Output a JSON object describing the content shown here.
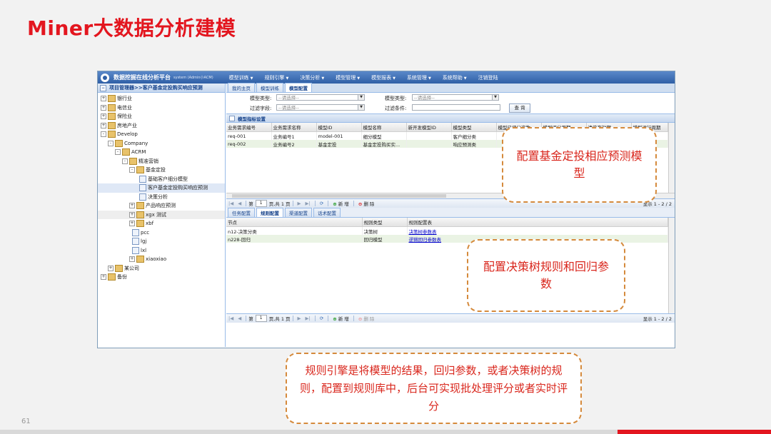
{
  "slide": {
    "title": "Miner大数据分析建模",
    "page_number": "61"
  },
  "app": {
    "title": "数据挖掘在线分析平台",
    "subtitle": "system (Admin小ACM)",
    "menu": [
      "模型训练",
      "规则引擎",
      "决策分析",
      "模型管理",
      "模型报表",
      "系统管理",
      "系统帮助",
      "注销登陆"
    ]
  },
  "left_panel": {
    "header": "项目管理器>>客户基金定投购买响应预测",
    "tree": [
      {
        "label": "银行业",
        "exp": "+"
      },
      {
        "label": "电信业",
        "exp": "+"
      },
      {
        "label": "保险业",
        "exp": "+"
      },
      {
        "label": "房地产业",
        "exp": "+"
      },
      {
        "label": "Develop",
        "exp": "-"
      },
      {
        "label": "Company",
        "exp": "-"
      },
      {
        "label": "ACRM",
        "exp": "-"
      },
      {
        "label": "精准营销",
        "exp": "-"
      },
      {
        "label": "基金定投",
        "exp": "-"
      },
      {
        "label": "基础客户细分模型",
        "exp": ""
      },
      {
        "label": "客户基金定投购买响应预测",
        "exp": ""
      },
      {
        "label": "决策分析",
        "exp": ""
      },
      {
        "label": "产品响应预测",
        "exp": "+"
      },
      {
        "label": "xgx 测试",
        "exp": "+"
      },
      {
        "label": "xbf",
        "exp": "+"
      },
      {
        "label": "pcc",
        "exp": ""
      },
      {
        "label": "lgj",
        "exp": ""
      },
      {
        "label": "lxl",
        "exp": ""
      },
      {
        "label": "xiaoxiao",
        "exp": "+"
      },
      {
        "label": "某公司",
        "exp": "+"
      },
      {
        "label": "备份",
        "exp": "+"
      }
    ]
  },
  "tabs": [
    "我的主页",
    "模型训练",
    "模型配置"
  ],
  "filter": {
    "model_type_label": "模型类型:",
    "model_type_placeholder": "--请选择--",
    "model_type2_label": "模型类型:",
    "model_type2_placeholder": "--请选择--",
    "filter_field_label": "过滤字段:",
    "filter_field_placeholder": "--请选择--",
    "filter_cond_label": "过滤条件:",
    "filter_cond_value": "",
    "query_button": "查 询"
  },
  "section1": {
    "title": "模型指标设置",
    "columns": [
      "业务需求编号",
      "业务需求名称",
      "模型ID",
      "模型名称",
      "新开发模型ID",
      "模型类型",
      "模型已评分次数",
      "模型评分周期",
      "清单有效期",
      "模型运行周期"
    ],
    "rows": [
      [
        "req-001",
        "业务编号1",
        "model-001",
        "细分模型",
        "",
        "客户细分类",
        "",
        "",
        "",
        ""
      ],
      [
        "req-002",
        "业务编号2",
        "基金定投",
        "基金定投购买实...",
        "",
        "响应预测类",
        "",
        "",
        "",
        ""
      ]
    ]
  },
  "pager": {
    "page_label": "第",
    "page": "1",
    "of_pages": "页,共 1 页",
    "add": "新 增",
    "delete": "删 除",
    "display": "显示 1 - 2 / 2"
  },
  "subtabs": [
    "任务配置",
    "规则配置",
    "渠道配置",
    "话术配置"
  ],
  "section2": {
    "columns": [
      "节点",
      "规则类型",
      "规则配置表"
    ],
    "rows": [
      [
        "n12-决策分类",
        "决策树",
        "决策树参数表"
      ],
      [
        "n228-回归",
        "回归模型",
        "逻辑回归参数表"
      ]
    ]
  },
  "callouts": {
    "c1": "配置基金定投相应预测模型",
    "c2": "配置决策树规则和回归参数",
    "c3": "规则引擎是将模型的结果，回归参数，或者决策树的规则，配置到规则库中，后台可实现批处理评分或者实时评分"
  },
  "colors": {
    "title_red": "#e3161f",
    "callout_border": "#d58a3c",
    "app_blue": "#2f5fa6"
  }
}
